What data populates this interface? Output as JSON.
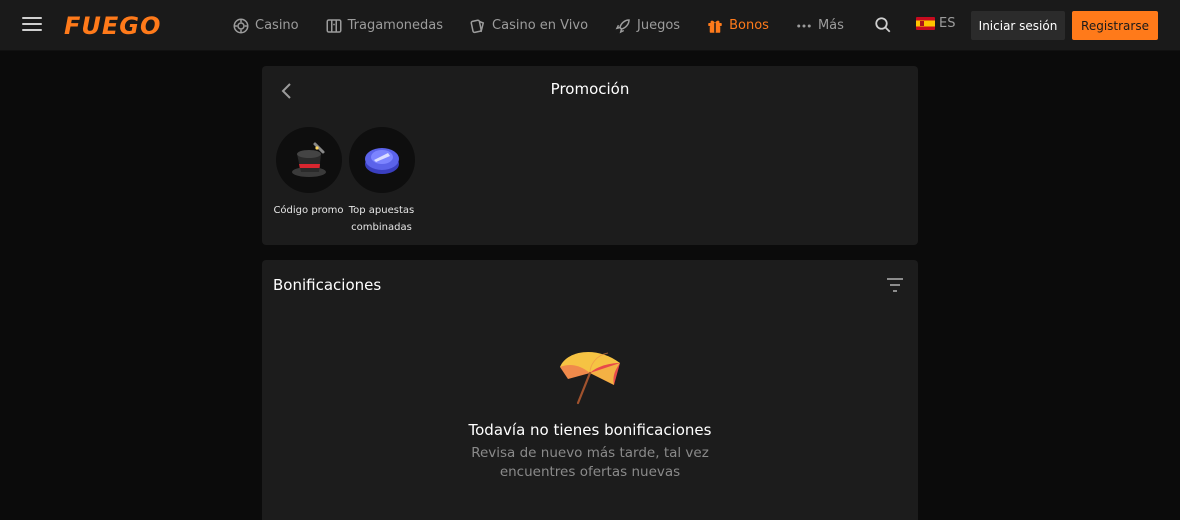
{
  "header": {
    "logo": "FUEGO",
    "nav": [
      {
        "label": "Casino",
        "icon": "casino-chip-icon",
        "active": false
      },
      {
        "label": "Tragamonedas",
        "icon": "slot-machine-icon",
        "active": false
      },
      {
        "label": "Casino en Vivo",
        "icon": "cards-icon",
        "active": false
      },
      {
        "label": "Juegos",
        "icon": "rocket-icon",
        "active": false
      },
      {
        "label": "Bonos",
        "icon": "gift-icon",
        "active": true
      },
      {
        "label": "Más",
        "icon": "dots-icon",
        "active": false
      }
    ],
    "language": "ES",
    "login_label": "Iniciar sesión",
    "register_label": "Registrarse"
  },
  "promo": {
    "title": "Promoción",
    "items": [
      {
        "label": "Código promo",
        "icon": "magic-hat-icon"
      },
      {
        "label": "Top apuestas combinadas",
        "icon": "puck-icon"
      }
    ]
  },
  "bonus": {
    "title": "Bonificaciones",
    "empty_title": "Todavía no tienes bonificaciones",
    "empty_subtitle": "Revisa de nuevo más tarde, tal vez encuentres ofertas nuevas"
  },
  "colors": {
    "accent": "#ff7a1a",
    "header_bg": "#1a1a1a",
    "panel_bg": "#1c1c1c",
    "page_bg": "#0b0b0b"
  }
}
